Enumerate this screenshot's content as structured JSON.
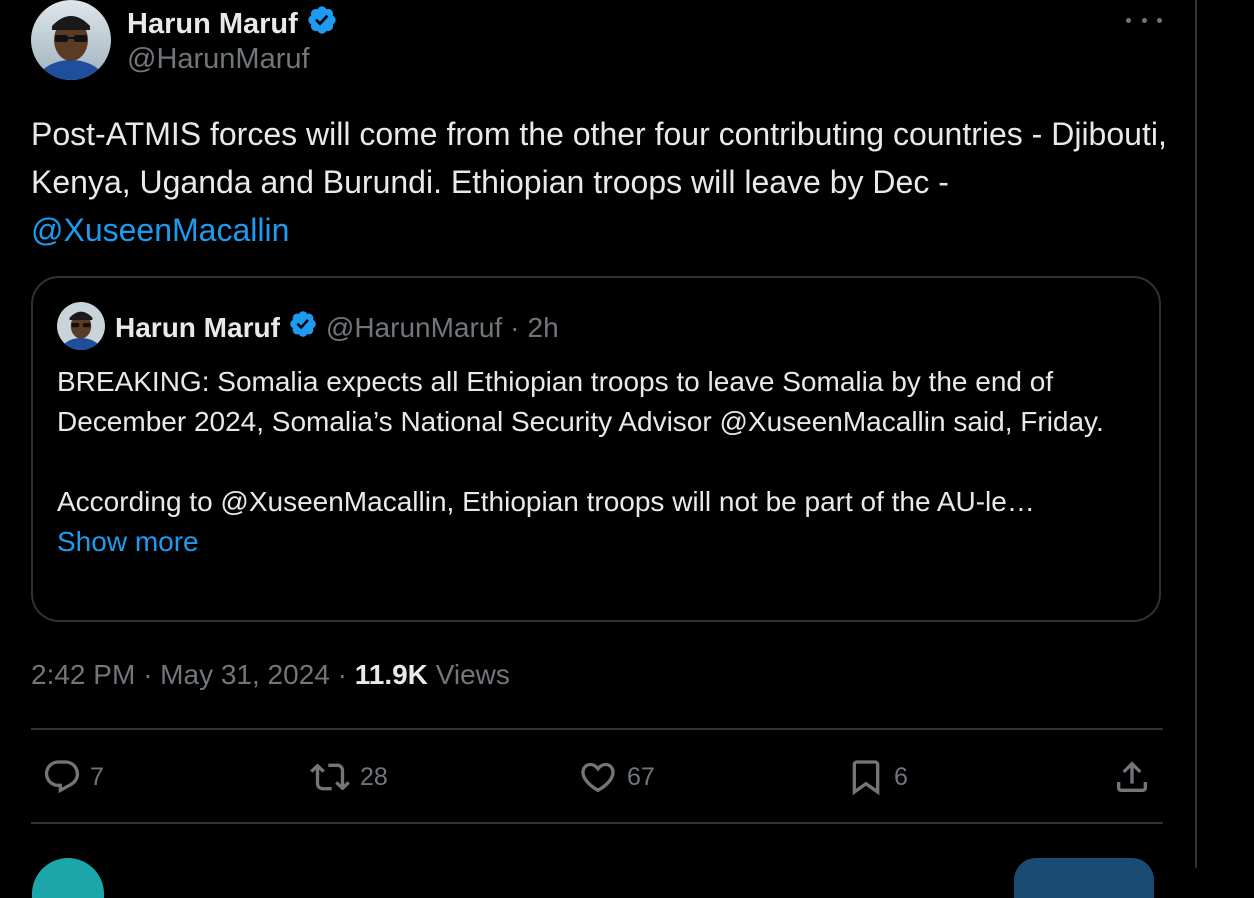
{
  "tweet": {
    "author": {
      "name": "Harun Maruf",
      "handle": "@HarunMaruf",
      "verified_color": "#1d9bf0"
    },
    "text_before": "Post-ATMIS forces will come from the other four contributing countries - Djibouti, Kenya, Uganda and Burundi. Ethiopian troops will leave by Dec - ",
    "mention": "@XuseenMacallin",
    "quote": {
      "name": "Harun Maruf",
      "handle": "@HarunMaruf",
      "separator": "·",
      "time": "2h",
      "para1": "BREAKING: Somalia expects all Ethiopian troops to leave Somalia by the end of December 2024, Somalia’s National Security Advisor @XuseenMacallin said, Friday.",
      "para2": "According to @XuseenMacallin, Ethiopian troops will not be part of the AU-le…",
      "show_more": "Show more"
    },
    "meta": {
      "time": "2:42 PM",
      "separator": "·",
      "date": "May 31, 2024",
      "views_count": "11.9K",
      "views_label": "Views"
    },
    "actions": {
      "replies": "7",
      "reposts": "28",
      "likes": "67",
      "bookmarks": "6"
    }
  },
  "icons": {
    "more": "more-horizontal-icon",
    "reply": "reply-icon",
    "repost": "repost-icon",
    "like": "heart-icon",
    "bookmark": "bookmark-icon",
    "share": "share-icon",
    "verified": "verified-badge-icon"
  },
  "colors": {
    "background": "#000000",
    "text": "#e7e9ea",
    "secondary": "#71767b",
    "accent": "#1d9bf0",
    "border": "#2f3336"
  }
}
